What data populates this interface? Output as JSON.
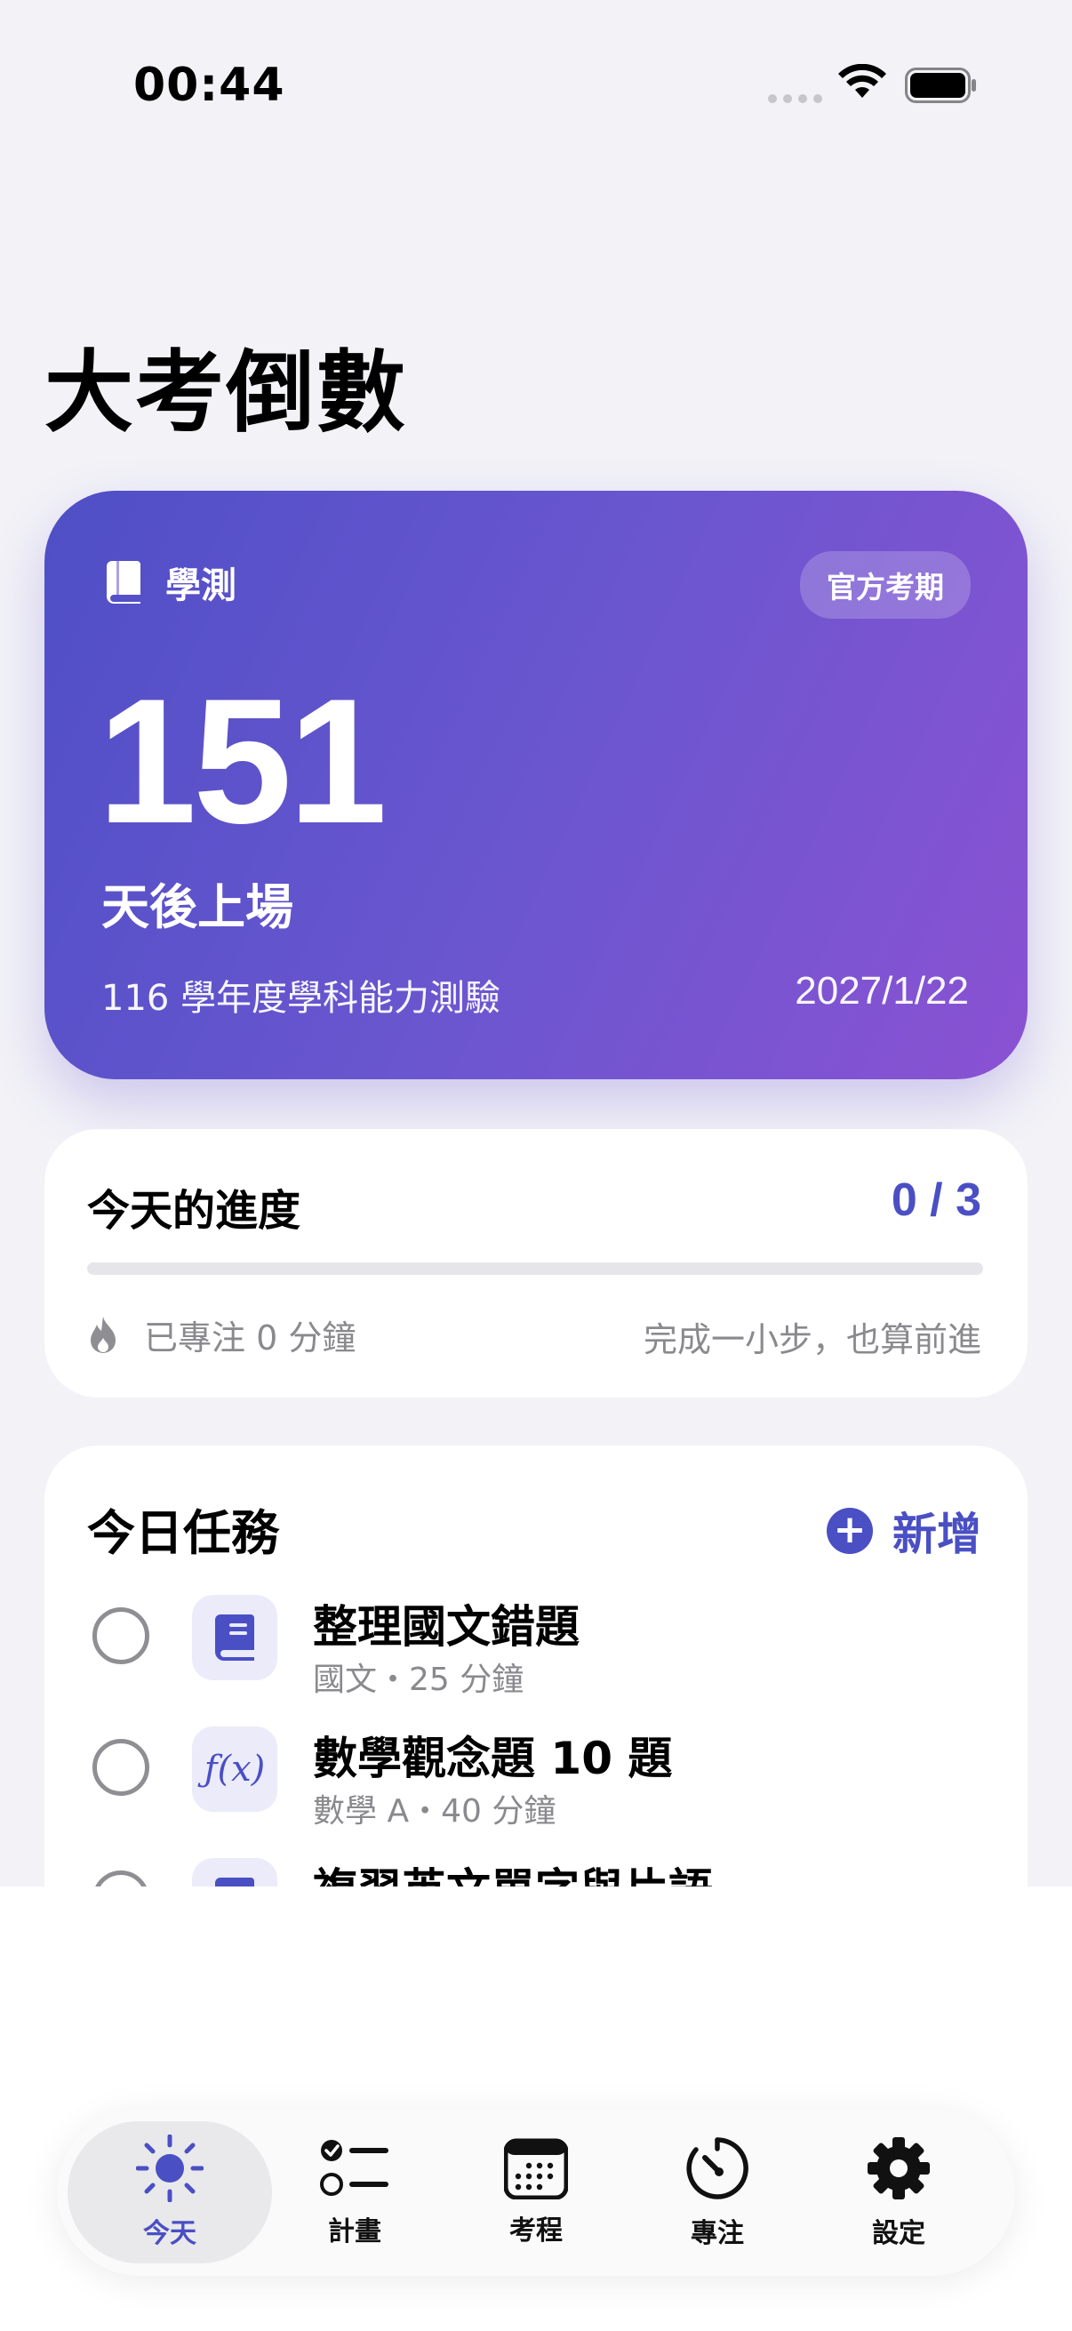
{
  "status_bar": {
    "time": "00:44"
  },
  "header": {
    "title": "大考倒數"
  },
  "countdown": {
    "exam_label": "學測",
    "badge": "官方考期",
    "days": "151",
    "days_suffix": "天後上場",
    "exam_name": "116 學年度學科能力測驗",
    "exam_date": "2027/1/22",
    "gradient_start": "#4f4fc6",
    "gradient_end": "#8a52d3"
  },
  "progress": {
    "title": "今天的進度",
    "count": "0 / 3",
    "completed": 0,
    "total": 3,
    "focus_text": "已專注 0 分鐘",
    "motto": "完成一小步，也算前進"
  },
  "tasks": {
    "title": "今日任務",
    "add_label": "新增",
    "items": [
      {
        "name": "整理國文錯題",
        "meta": "國文・25 分鐘",
        "icon": "book-icon"
      },
      {
        "name": "數學觀念題 10 題",
        "meta": "數學 A・40 分鐘",
        "icon": "function-icon",
        "icon_text": "ƒ(x)"
      },
      {
        "name": "複習英文單字與片語",
        "meta": "",
        "icon": "book-icon"
      }
    ]
  },
  "tab_bar": {
    "tabs": [
      {
        "label": "今天",
        "icon": "sun-icon",
        "active": true
      },
      {
        "label": "計畫",
        "icon": "checklist-icon",
        "active": false
      },
      {
        "label": "考程",
        "icon": "calendar-icon",
        "active": false
      },
      {
        "label": "專注",
        "icon": "timer-icon",
        "active": false
      },
      {
        "label": "設定",
        "icon": "gear-icon",
        "active": false
      }
    ]
  },
  "colors": {
    "accent": "#4a4fc4",
    "background": "#f2f2f7"
  }
}
